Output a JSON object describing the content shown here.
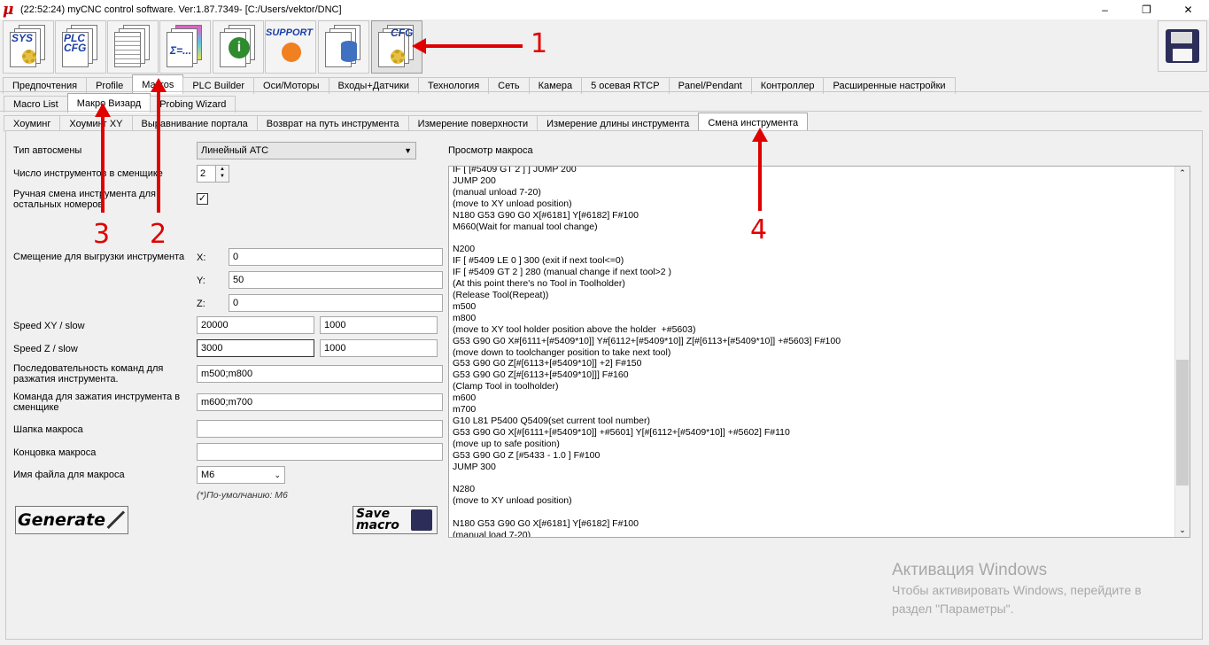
{
  "titlebar": {
    "logo": "μ",
    "title": "(22:52:24)   myCNC control software. Ver:1.87.7349-   [C:/Users/vektor/DNC]",
    "minimize": "–",
    "maximize": "❐",
    "close": "✕"
  },
  "toolbar": {
    "buttons": [
      {
        "label": "SYS"
      },
      {
        "label": "PLC CFG"
      },
      {
        "label": ""
      },
      {
        "label": "Σ=..."
      },
      {
        "label": "i"
      },
      {
        "label": "SUPPORT"
      },
      {
        "label": ""
      },
      {
        "label": "CFG"
      }
    ]
  },
  "tabs_main": [
    "Предпочтения",
    "Profile",
    "Macros",
    "PLC Builder",
    "Оси/Моторы",
    "Входы+Датчики",
    "Технология",
    "Сеть",
    "Камера",
    "5 осевая RTCP",
    "Panel/Pendant",
    "Контроллер",
    "Расширенные настройки"
  ],
  "tabs_macros": [
    "Macro List",
    "Макро Визард",
    "Probing Wizard"
  ],
  "tabs_wizard": [
    "Хоуминг",
    "Хоуминг XY",
    "Выравнивание портала",
    "Возврат на путь инструмента",
    "Измерение поверхности",
    "Измерение длины инструмента",
    "Смена инструмента"
  ],
  "form": {
    "atc_type_label": "Тип автосмены",
    "atc_type_value": "Линейный ATC",
    "tool_count_label": "Число инструментов в сменщике",
    "tool_count_value": "2",
    "manual_change_label": "Ручная смена инструмента для остальных номеров",
    "manual_change_check": "✓",
    "unload_offset_label": "Смещение для выгрузки инструмента",
    "x_label": "X:",
    "x_value": "0",
    "y_label": "Y:",
    "y_value": "50",
    "z_label": "Z:",
    "z_value": "0",
    "speed_xy_label": "Speed XY / slow",
    "speed_xy_value": "20000",
    "speed_xy_slow": "1000",
    "speed_z_label": "Speed Z / slow",
    "speed_z_value": "3000",
    "speed_z_slow": "1000",
    "unclamp_label": "Последовательность команд для разжатия инструмента.",
    "unclamp_value": "m500;m800",
    "clamp_label": "Команда для зажатия инструмента в сменщике",
    "clamp_value": "m600;m700",
    "header_label": "Шапка макроса",
    "header_value": "",
    "footer_label": "Концовка макроса",
    "footer_value": "",
    "filename_label": "Имя файла для макроса",
    "filename_value": "M6",
    "default_note": "(*)По-умолчанию: M6",
    "generate_label": "Generate",
    "save_label": "Save macro"
  },
  "preview": {
    "label": "Просмотр макроса",
    "code": "IF [ [#5409 GT 2 ] ] JUMP 200\nJUMP 200\n(manual unload 7-20)\n(move to XY unload position)\nN180 G53 G90 G0 X[#6181] Y[#6182] F#100\nM660(Wait for manual tool change)\n\nN200\nIF [ #5409 LE 0 ] 300 (exit if next tool<=0)\nIF [ #5409 GT 2 ] 280 (manual change if next tool>2 )\n(At this point there's no Tool in Toolholder)\n(Release Tool(Repeat))\nm500\nm800\n(move to XY tool holder position above the holder  +#5603)\nG53 G90 G0 X#[6111+[#5409*10]] Y#[6112+[#5409*10]] Z[#[6113+[#5409*10]] +#5603] F#100\n(move down to toolchanger position to take next tool)\nG53 G90 G0 Z[#[6113+[#5409*10]] +2] F#150\nG53 G90 G0 Z[#[6113+[#5409*10]]] F#160\n(Clamp Tool in toolholder)\nm600\nm700\nG10 L81 P5400 Q5409(set current tool number)\nG53 G90 G0 X[#[6111+[#5409*10]] +#5601] Y[#[6112+[#5409*10]] +#5602] F#110\n(move up to safe position)\nG53 G90 G0 Z [#5433 - 1.0 ] F#100\nJUMP 300\n\nN280\n(move to XY unload position)\n\nN180 G53 G90 G0 X[#6181] Y[#6182] F#100\n(manual load 7-20)"
  },
  "annotations": [
    "1",
    "2",
    "3",
    "4"
  ],
  "watermark": {
    "title": "Активация Windows",
    "line1": "Чтобы активировать Windows, перейдите в",
    "line2": "раздел \"Параметры\"."
  },
  "colors": {
    "annotation": "#e00000",
    "logo": "#c00000"
  }
}
